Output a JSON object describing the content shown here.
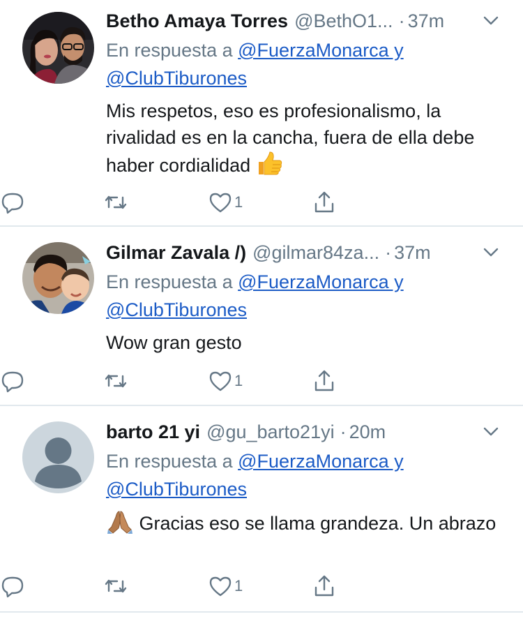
{
  "tweets": [
    {
      "name": "Betho Amaya Torres",
      "handle": "@BethO1...",
      "time": "37m",
      "reply_prefix": "En respuesta a",
      "mention_line1": "@FuerzaMonarca y",
      "mention_line2": "@ClubTiburones",
      "text": "Mis respetos, eso es profesionalismo, la rivalidad es en la cancha, fuera de ella debe haber cordialidad",
      "emoji": "thumbs-up",
      "like_count": "1"
    },
    {
      "name": "Gilmar Zavala /)",
      "handle": "@gilmar84za...",
      "time": "37m",
      "reply_prefix": "En respuesta a",
      "mention_line1": "@FuerzaMonarca y",
      "mention_line2": "@ClubTiburones",
      "text": "Wow gran gesto",
      "like_count": "1"
    },
    {
      "name": "barto 21 yi",
      "handle": "@gu_barto21yi",
      "time": "20m",
      "reply_prefix": "En respuesta a",
      "mention_line1": "@FuerzaMonarca y",
      "mention_line2": "@ClubTiburones",
      "emoji": "folded-hands",
      "text": "Gracias eso se llama grandeza.  Un abrazo",
      "like_count": "1"
    }
  ],
  "colors": {
    "text": "#14171a",
    "muted": "#657786",
    "link": "#1b5bc6",
    "divider": "#e1e8ed"
  },
  "icons": [
    "reply-icon",
    "retweet-icon",
    "heart-icon",
    "share-icon",
    "chevron-down-icon"
  ]
}
